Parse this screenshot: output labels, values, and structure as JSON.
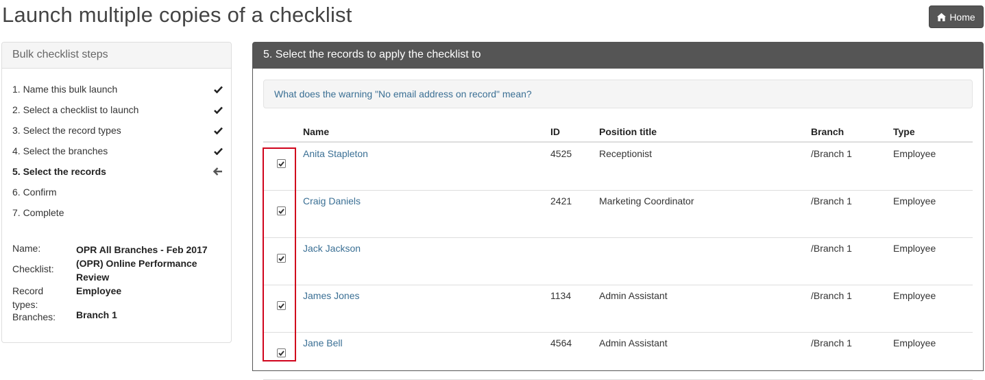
{
  "page": {
    "title": "Launch multiple copies of a checklist"
  },
  "header": {
    "home_label": "Home",
    "home_icon": "home-icon"
  },
  "steps_panel": {
    "heading": "Bulk checklist steps",
    "steps": [
      {
        "label": "1. Name this bulk launch",
        "status": "done"
      },
      {
        "label": "2. Select a checklist to launch",
        "status": "done"
      },
      {
        "label": "3. Select the record types",
        "status": "done"
      },
      {
        "label": "4. Select the branches",
        "status": "done"
      },
      {
        "label": "5. Select the records",
        "status": "current"
      },
      {
        "label": "6. Confirm",
        "status": "pending"
      },
      {
        "label": "7. Complete",
        "status": "pending"
      }
    ],
    "summary": {
      "name_label": "Name:",
      "name_value": "OPR All Branches - Feb 2017",
      "checklist_label": "Checklist:",
      "checklist_value": "(OPR) Online Performance Review",
      "record_types_label": "Record types:",
      "record_types_value": "Employee",
      "branches_label": "Branches:",
      "branches_value": "Branch 1"
    }
  },
  "records_panel": {
    "heading": "5. Select the records to apply the checklist to",
    "warning_link": "What does the warning \"No email address on record\" mean?",
    "columns": [
      "Name",
      "ID",
      "Position title",
      "Branch",
      "Type"
    ],
    "rows": [
      {
        "name": "Anita Stapleton",
        "id": "4525",
        "position": "Receptionist",
        "branch": "/Branch 1",
        "type": "Employee",
        "checked": true
      },
      {
        "name": "Craig Daniels",
        "id": "2421",
        "position": "Marketing Coordinator",
        "branch": "/Branch 1",
        "type": "Employee",
        "checked": true
      },
      {
        "name": "Jack Jackson",
        "id": "",
        "position": "",
        "branch": "/Branch 1",
        "type": "Employee",
        "checked": true
      },
      {
        "name": "James Jones",
        "id": "1134",
        "position": "Admin Assistant",
        "branch": "/Branch 1",
        "type": "Employee",
        "checked": true
      },
      {
        "name": "Jane Bell",
        "id": "4564",
        "position": "Admin Assistant",
        "branch": "/Branch 1",
        "type": "Employee",
        "checked": true
      }
    ]
  },
  "colors": {
    "dark_header": "#555555",
    "link": "#3a6f94",
    "highlight_border": "#d0021b"
  }
}
